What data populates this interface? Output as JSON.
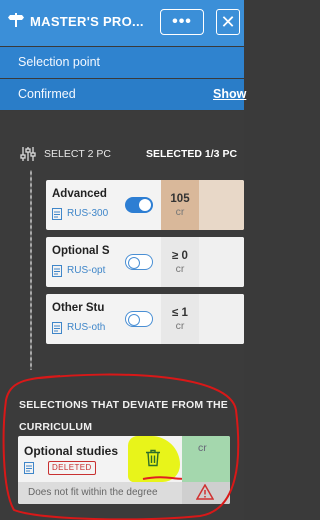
{
  "header": {
    "title": "MASTER'S PRO...",
    "more_label": "•••",
    "close_label": "✕"
  },
  "status": {
    "selection_point": "Selection point",
    "confirmed": "Confirmed",
    "show_link": "Show"
  },
  "group": {
    "select_label": "SELECT 2 PC",
    "selected_count": "SELECTED 1/3 PC"
  },
  "courses": [
    {
      "title": "Advanced",
      "code": "RUS-300",
      "toggle_on": true,
      "credits": "105",
      "unit": "cr",
      "credit_color": "#d9b89a"
    },
    {
      "title": "Optional S",
      "code": "RUS-opt",
      "toggle_on": false,
      "credits": "≥ 0",
      "unit": "cr",
      "credit_color": "#e8e8e8"
    },
    {
      "title": "Other Stu",
      "code": "RUS-oth",
      "toggle_on": false,
      "credits": "≤ 1",
      "unit": "cr",
      "credit_color": "#e8e8e8"
    }
  ],
  "deviations": {
    "heading": "SELECTIONS THAT DEVIATE FROM THE CURRICULUM",
    "card": {
      "title": "Optional studies",
      "badge": "DELETED",
      "unit": "cr",
      "warning": "Does not fit within the degree"
    }
  },
  "icons": {
    "title": "signpost-icon",
    "select": "sliders-icon",
    "code": "document-icon",
    "trash": "trash-icon",
    "warning": "warning-triangle-icon"
  },
  "colors": {
    "header_blue": "#3b8fd8",
    "toggle_blue": "#2d7ed3",
    "deleted_red": "#c83030",
    "highlight_yellow": "#e8f41a",
    "credit_green": "#a4d7ad"
  }
}
